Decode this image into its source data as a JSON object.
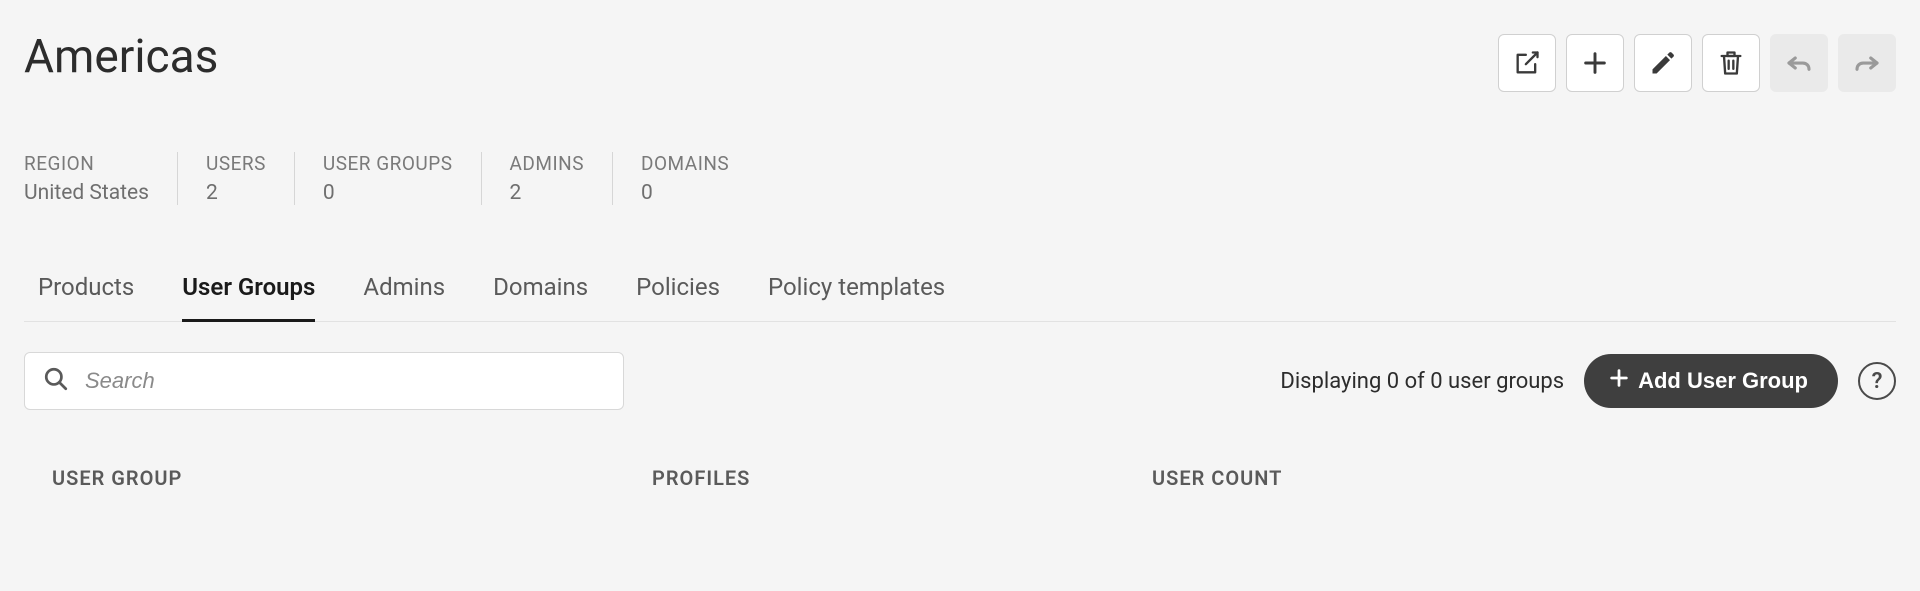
{
  "header": {
    "title": "Americas"
  },
  "toolbar": {
    "share": {
      "name": "share"
    },
    "add": {
      "name": "add"
    },
    "edit": {
      "name": "edit"
    },
    "delete": {
      "name": "delete"
    },
    "undo": {
      "name": "undo",
      "disabled": true
    },
    "redo": {
      "name": "redo",
      "disabled": true
    }
  },
  "stats": [
    {
      "label": "REGION",
      "value": "United States"
    },
    {
      "label": "USERS",
      "value": "2"
    },
    {
      "label": "USER GROUPS",
      "value": "0"
    },
    {
      "label": "ADMINS",
      "value": "2"
    },
    {
      "label": "DOMAINS",
      "value": "0"
    }
  ],
  "tabs": [
    {
      "label": "Products",
      "active": false
    },
    {
      "label": "User Groups",
      "active": true
    },
    {
      "label": "Admins",
      "active": false
    },
    {
      "label": "Domains",
      "active": false
    },
    {
      "label": "Policies",
      "active": false
    },
    {
      "label": "Policy templates",
      "active": false
    }
  ],
  "search": {
    "placeholder": "Search",
    "value": ""
  },
  "listing": {
    "display_text": "Displaying 0 of 0 user groups",
    "add_button_label": "Add User Group",
    "help_label": "?"
  },
  "columns": {
    "group": "USER GROUP",
    "profiles": "PROFILES",
    "count": "USER COUNT"
  }
}
